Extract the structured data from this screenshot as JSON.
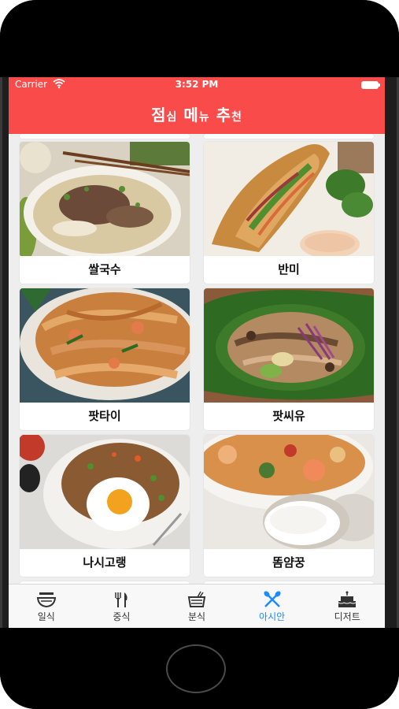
{
  "status_bar": {
    "carrier": "Carrier",
    "time": "3:52 PM"
  },
  "header": {
    "title_a": "점",
    "title_b": "심",
    "title_c": "메",
    "title_d": "뉴",
    "title_e": "추",
    "title_f": "천"
  },
  "menu": {
    "items": [
      {
        "label": "쌀국수",
        "image": "pho-noodle-soup"
      },
      {
        "label": "반미",
        "image": "banh-mi-sandwich"
      },
      {
        "label": "팟타이",
        "image": "pad-thai"
      },
      {
        "label": "팟씨유",
        "image": "pad-see-ew"
      },
      {
        "label": "나시고랭",
        "image": "nasi-goreng"
      },
      {
        "label": "똠얌꿍",
        "image": "tom-yum-goong"
      }
    ]
  },
  "tabbar": {
    "active_index": 3,
    "tabs": [
      {
        "label": "일식",
        "icon": "bowl-icon"
      },
      {
        "label": "중식",
        "icon": "fork-knife-icon"
      },
      {
        "label": "분식",
        "icon": "snack-tray-icon"
      },
      {
        "label": "아시안",
        "icon": "crossed-utensils-icon"
      },
      {
        "label": "디저트",
        "icon": "cake-icon"
      }
    ]
  },
  "colors": {
    "brand_red": "#fa4b4b",
    "active_tab": "#1a8cff"
  }
}
